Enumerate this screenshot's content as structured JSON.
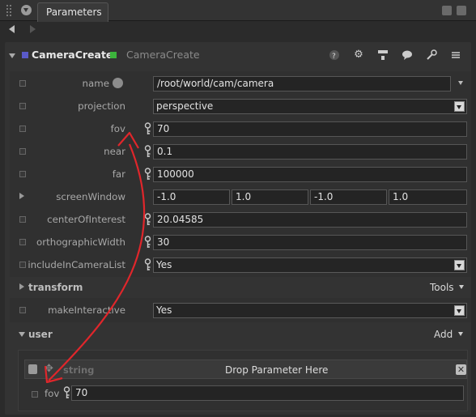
{
  "tab": {
    "title": "Parameters"
  },
  "node": {
    "name": "CameraCreate",
    "type": "CameraCreate"
  },
  "colors": {
    "accent_square": "#5a5ac8",
    "status_square": "#3cb43c",
    "annotation": "#e0262b"
  },
  "header_icons": [
    "help-icon",
    "gear-icon",
    "network-icon",
    "comment-icon",
    "wrench-icon",
    "menu-icon"
  ],
  "params": {
    "name": {
      "label": "name",
      "value": "/root/world/cam/camera"
    },
    "projection": {
      "label": "projection",
      "value": "perspective"
    },
    "fov": {
      "label": "fov",
      "value": "70"
    },
    "near": {
      "label": "near",
      "value": "0.1"
    },
    "far": {
      "label": "far",
      "value": "100000"
    },
    "screenWindow": {
      "label": "screenWindow",
      "values": [
        "-1.0",
        "1.0",
        "-1.0",
        "1.0"
      ]
    },
    "centerOfInterest": {
      "label": "centerOfInterest",
      "value": "20.04585"
    },
    "orthographicWidth": {
      "label": "orthographicWidth",
      "value": "30"
    },
    "includeInCameraList": {
      "label": "includeInCameraList",
      "value": "Yes"
    }
  },
  "transform": {
    "title": "transform",
    "tools_label": "Tools"
  },
  "makeInteractive": {
    "label": "makeInteractive",
    "value": "Yes"
  },
  "user": {
    "title": "user",
    "add_label": "Add",
    "drop_type": "string",
    "drop_label": "Drop Parameter Here",
    "fov_label": "fov",
    "fov_value": "70"
  }
}
